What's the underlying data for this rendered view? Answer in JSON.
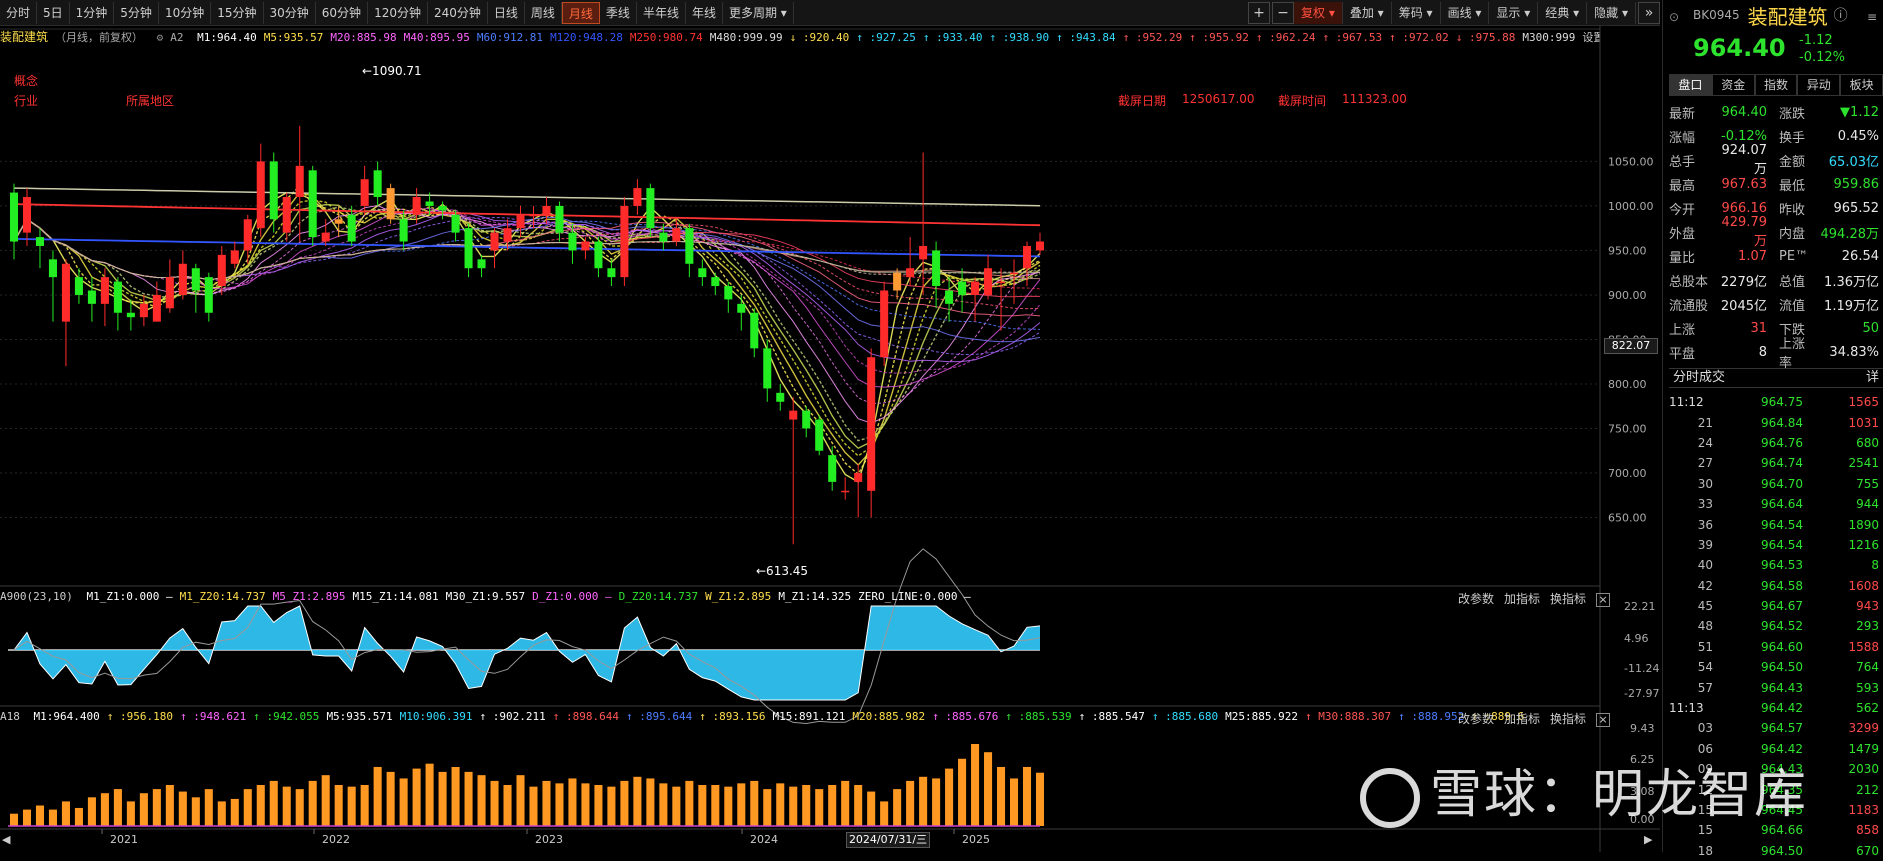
{
  "toolbar": {
    "periods": [
      "分时",
      "5日",
      "1分钟",
      "5分钟",
      "10分钟",
      "15分钟",
      "30分钟",
      "60分钟",
      "120分钟",
      "240分钟",
      "日线",
      "周线",
      "月线",
      "季线",
      "半年线",
      "年线",
      "更多周期"
    ],
    "active_period": "月线",
    "right": [
      "复权",
      "叠加",
      "筹码",
      "画线",
      "显示",
      "经典",
      "隐藏"
    ],
    "zoom_in": "+",
    "zoom_out": "−"
  },
  "chart": {
    "title": "装配建筑",
    "subtitle": "（月线，前复权）",
    "tag": "A2",
    "ma_items": [
      {
        "t": "M1:964.40",
        "c": "#ffffff"
      },
      {
        "t": "M5:935.57",
        "c": "#ffdf4c"
      },
      {
        "t": "M20:885.98",
        "c": "#ff66ff"
      },
      {
        "t": "M40:895.95",
        "c": "#ff66ff"
      },
      {
        "t": "M60:912.81",
        "c": "#4d7dff"
      },
      {
        "t": "M120:948.28",
        "c": "#3355ff"
      },
      {
        "t": "M250:980.74",
        "c": "#ff3333"
      },
      {
        "t": "M480:999.99",
        "c": "#dddddd"
      },
      {
        "t": "↓ :920.40",
        "c": "#ffdf4c"
      },
      {
        "t": "↑ :927.25",
        "c": "#33ddff"
      },
      {
        "t": "↑ :933.40",
        "c": "#33ddff"
      },
      {
        "t": "↑ :938.90",
        "c": "#33ddff"
      },
      {
        "t": "↑ :943.84",
        "c": "#33ddff"
      },
      {
        "t": "↑ :952.29",
        "c": "#ff5555"
      },
      {
        "t": "↑ :955.92",
        "c": "#ff5555"
      },
      {
        "t": "↑ :962.24",
        "c": "#ff5555"
      },
      {
        "t": "↑ :967.53",
        "c": "#ff5555"
      },
      {
        "t": "↑ :972.02",
        "c": "#ff5555"
      },
      {
        "t": "↓ :975.88",
        "c": "#ff5555"
      },
      {
        "t": "M300:999",
        "c": "#dddddd"
      }
    ],
    "settings": "设置均线",
    "concept_label": "概念",
    "industry_label": "行业",
    "region_label": "所属地区",
    "screen_date_label": "截屏日期",
    "screen_date": "1250617.00",
    "screen_time_label": "截屏时间",
    "screen_time": "111323.00",
    "high_marker": "←1090.71",
    "low_marker": "←613.45",
    "y_ticks": [
      "1050.00",
      "1000.00",
      "950.00",
      "900.00",
      "850.00",
      "800.00",
      "750.00",
      "700.00",
      "650.00"
    ],
    "cursor_value": "822.07",
    "x_labels": [
      "2021",
      "2022",
      "2023",
      "2024",
      "2025"
    ],
    "cursor_date": "2024/07/31/三"
  },
  "chart_data": [
    {
      "type": "candlestick",
      "title": "装配建筑",
      "ylim": [
        600,
        1110
      ],
      "open": [
        1015,
        970,
        965,
        940,
        870,
        920,
        905,
        890,
        915,
        880,
        875,
        870,
        885,
        900,
        930,
        920,
        910,
        935,
        950,
        975,
        1050,
        970,
        1010,
        1040,
        960,
        985,
        990,
        1000,
        1040,
        1020,
        985,
        990,
        1005,
        1000,
        990,
        975,
        940,
        950,
        960,
        975,
        990,
        990,
        1000,
        970,
        950,
        960,
        930,
        920,
        1000,
        1020,
        970,
        960,
        975,
        930,
        920,
        910,
        890,
        880,
        840,
        790,
        760,
        770,
        760,
        720,
        680,
        690,
        680,
        830,
        905,
        920,
        940,
        950,
        905,
        915,
        900,
        900,
        915,
        925,
        930,
        950
      ],
      "close": [
        960,
        1010,
        955,
        920,
        935,
        900,
        890,
        920,
        880,
        875,
        890,
        900,
        920,
        935,
        905,
        880,
        945,
        950,
        985,
        1050,
        985,
        1010,
        1045,
        965,
        970,
        980,
        960,
        1030,
        1010,
        985,
        960,
        1010,
        1000,
        995,
        970,
        930,
        930,
        970,
        975,
        990,
        990,
        1000,
        970,
        950,
        960,
        930,
        920,
        1000,
        1020,
        975,
        960,
        975,
        935,
        920,
        910,
        895,
        880,
        840,
        795,
        780,
        770,
        750,
        725,
        690,
        680,
        700,
        830,
        905,
        925,
        930,
        955,
        910,
        890,
        900,
        915,
        930,
        915,
        925,
        955,
        960
      ],
      "high": [
        1025,
        1020,
        975,
        950,
        940,
        930,
        920,
        930,
        920,
        895,
        900,
        915,
        940,
        950,
        935,
        925,
        955,
        960,
        990,
        1070,
        1060,
        1015,
        1090,
        1045,
        985,
        1000,
        1000,
        1045,
        1050,
        1025,
        995,
        1020,
        1015,
        1005,
        995,
        980,
        945,
        975,
        985,
        1000,
        1000,
        1010,
        1005,
        980,
        965,
        965,
        940,
        1010,
        1030,
        1025,
        980,
        985,
        980,
        940,
        925,
        915,
        900,
        885,
        850,
        800,
        785,
        775,
        765,
        730,
        695,
        710,
        840,
        915,
        930,
        965,
        1060,
        960,
        920,
        930,
        920,
        945,
        930,
        940,
        960,
        970
      ],
      "low": [
        940,
        955,
        930,
        870,
        820,
        890,
        870,
        865,
        860,
        860,
        865,
        870,
        880,
        895,
        880,
        870,
        900,
        930,
        935,
        965,
        970,
        960,
        960,
        955,
        955,
        965,
        955,
        990,
        1000,
        980,
        950,
        980,
        990,
        985,
        960,
        920,
        920,
        930,
        950,
        965,
        975,
        980,
        960,
        935,
        940,
        920,
        910,
        910,
        990,
        965,
        950,
        955,
        920,
        910,
        900,
        880,
        860,
        830,
        780,
        770,
        620,
        740,
        720,
        680,
        670,
        650,
        650,
        820,
        895,
        910,
        900,
        885,
        870,
        880,
        870,
        895,
        860,
        890,
        910,
        945
      ],
      "volume_levels": [
        0.15,
        0.2,
        0.25,
        0.2,
        0.3,
        0.22,
        0.35,
        0.4,
        0.45,
        0.3,
        0.4,
        0.45,
        0.5,
        0.42,
        0.35,
        0.45,
        0.3,
        0.33,
        0.45,
        0.5,
        0.55,
        0.48,
        0.45,
        0.55,
        0.62,
        0.5,
        0.48,
        0.5,
        0.72,
        0.66,
        0.58,
        0.7,
        0.76,
        0.66,
        0.72,
        0.66,
        0.62,
        0.55,
        0.5,
        0.62,
        0.48,
        0.55,
        0.52,
        0.58,
        0.52,
        0.5,
        0.48,
        0.55,
        0.6,
        0.58,
        0.52,
        0.48,
        0.55,
        0.5,
        0.5,
        0.48,
        0.52,
        0.55,
        0.45,
        0.52,
        0.48,
        0.5,
        0.45,
        0.5,
        0.55,
        0.5,
        0.42,
        0.3,
        0.45,
        0.55,
        0.6,
        0.58,
        0.7,
        0.82,
        1.0,
        0.9,
        0.72,
        0.58,
        0.72,
        0.65
      ]
    }
  ],
  "sub1": {
    "title": "A900(23,10)",
    "items": [
      {
        "t": "M1_Z1:0.000 —",
        "c": "#ffffff"
      },
      {
        "t": "M1_Z20:14.737",
        "c": "#ffdf4c"
      },
      {
        "t": "M5_Z1:2.895",
        "c": "#ff66ff"
      },
      {
        "t": "M15_Z1:14.081",
        "c": "#ffffff"
      },
      {
        "t": "M30_Z1:9.557",
        "c": "#ffffff"
      },
      {
        "t": "D_Z1:0.000 —",
        "c": "#ff66ff"
      },
      {
        "t": "D_Z20:14.737",
        "c": "#2ee32e"
      },
      {
        "t": "W_Z1:2.895",
        "c": "#ffdf4c"
      },
      {
        "t": "M_Z1:14.325",
        "c": "#ffffff"
      },
      {
        "t": "ZERO_LINE:0.000 —",
        "c": "#ffffff"
      }
    ],
    "y_ticks": [
      "22.21",
      "4.96",
      "-11.24",
      "-27.97"
    ],
    "controls": [
      "改参数",
      "加指标",
      "换指标"
    ]
  },
  "sub2": {
    "title": "A18",
    "items": [
      {
        "t": "M1:964.400",
        "c": "#ffffff"
      },
      {
        "t": "↑ :956.180",
        "c": "#ffdf4c"
      },
      {
        "t": "↑ :948.621",
        "c": "#ff66ff"
      },
      {
        "t": "↑ :942.055",
        "c": "#2ee32e"
      },
      {
        "t": "M5:935.571",
        "c": "#ffffff"
      },
      {
        "t": "M10:906.391",
        "c": "#33ddff"
      },
      {
        "t": "↑ :902.211",
        "c": "#ffffff"
      },
      {
        "t": "↑ :898.644",
        "c": "#ff5555"
      },
      {
        "t": "↑ :895.644",
        "c": "#4d7dff"
      },
      {
        "t": "↑ :893.156",
        "c": "#ffdf4c"
      },
      {
        "t": "M15:891.121",
        "c": "#ffffff"
      },
      {
        "t": "M20:885.982",
        "c": "#ffdf4c"
      },
      {
        "t": "↑ :885.676",
        "c": "#ff66ff"
      },
      {
        "t": "↑ :885.539",
        "c": "#2ee32e"
      },
      {
        "t": "↑ :885.547",
        "c": "#ffffff"
      },
      {
        "t": "↑ :885.680",
        "c": "#33ddff"
      },
      {
        "t": "M25:885.922",
        "c": "#ffffff"
      },
      {
        "t": "↑ M30:888.307",
        "c": "#ff5555"
      },
      {
        "t": "↑ :888.952",
        "c": "#4d7dff"
      },
      {
        "t": "↑ :889.6",
        "c": "#ffdf4c"
      }
    ],
    "y_ticks": [
      "9.43",
      "6.25",
      "3.08",
      "0.00"
    ],
    "controls": [
      "改参数",
      "加指标",
      "换指标"
    ]
  },
  "side": {
    "code": "BK0945",
    "name": "装配建筑",
    "price": "964.40",
    "change": "-1.12",
    "change_pct": "-0.12%",
    "tabs": [
      "盘口",
      "资金",
      "指数",
      "异动",
      "板块"
    ],
    "quote": [
      {
        "l1": "最新",
        "v1": "964.40",
        "c1": "g",
        "l2": "涨跌",
        "v2": "▼1.12",
        "c2": "g"
      },
      {
        "l1": "涨幅",
        "v1": "-0.12%",
        "c1": "g",
        "l2": "换手",
        "v2": "0.45%",
        "c2": "w"
      },
      {
        "l1": "总手",
        "v1": "924.07万",
        "c1": "w",
        "l2": "金额",
        "v2": "65.03亿",
        "c2": "c"
      },
      {
        "l1": "最高",
        "v1": "967.63",
        "c1": "r",
        "l2": "最低",
        "v2": "959.86",
        "c2": "g"
      },
      {
        "l1": "今开",
        "v1": "966.16",
        "c1": "r",
        "l2": "昨收",
        "v2": "965.52",
        "c2": "w"
      },
      {
        "l1": "外盘",
        "v1": "429.79万",
        "c1": "r",
        "l2": "内盘",
        "v2": "494.28万",
        "c2": "g"
      },
      {
        "l1": "量比",
        "v1": "1.07",
        "c1": "r",
        "l2": "PE™",
        "v2": "26.54",
        "c2": "w"
      },
      {
        "l1": "总股本",
        "v1": "2279亿",
        "c1": "w",
        "l2": "总值",
        "v2": "1.36万亿",
        "c2": "w"
      },
      {
        "l1": "流通股",
        "v1": "2045亿",
        "c1": "w",
        "l2": "流值",
        "v2": "1.19万亿",
        "c2": "w"
      },
      {
        "l1": "上涨",
        "v1": "31",
        "c1": "r",
        "l2": "下跌",
        "v2": "50",
        "c2": "g"
      },
      {
        "l1": "平盘",
        "v1": "8",
        "c1": "w",
        "l2": "上涨率",
        "v2": "34.83%",
        "c2": "w"
      }
    ],
    "ticks_title": "分时成交",
    "ticks_detail": "详",
    "ticks": [
      {
        "t": "11:12",
        "p": "964.75",
        "v": "1565",
        "vc": "r",
        "full": true
      },
      {
        "t": "21",
        "p": "964.84",
        "v": "1031",
        "vc": "r"
      },
      {
        "t": "24",
        "p": "964.76",
        "v": "680",
        "vc": "g"
      },
      {
        "t": "27",
        "p": "964.74",
        "v": "2541",
        "vc": "g"
      },
      {
        "t": "30",
        "p": "964.70",
        "v": "755",
        "vc": "g"
      },
      {
        "t": "33",
        "p": "964.64",
        "v": "944",
        "vc": "g"
      },
      {
        "t": "36",
        "p": "964.54",
        "v": "1890",
        "vc": "g"
      },
      {
        "t": "39",
        "p": "964.54",
        "v": "1216",
        "vc": "g"
      },
      {
        "t": "40",
        "p": "964.53",
        "v": "8",
        "vc": "g"
      },
      {
        "t": "42",
        "p": "964.58",
        "v": "1608",
        "vc": "r"
      },
      {
        "t": "45",
        "p": "964.67",
        "v": "943",
        "vc": "r"
      },
      {
        "t": "48",
        "p": "964.52",
        "v": "293",
        "vc": "g"
      },
      {
        "t": "51",
        "p": "964.60",
        "v": "1588",
        "vc": "r"
      },
      {
        "t": "54",
        "p": "964.50",
        "v": "764",
        "vc": "g"
      },
      {
        "t": "57",
        "p": "964.43",
        "v": "593",
        "vc": "g"
      },
      {
        "t": "11:13",
        "p": "964.42",
        "v": "562",
        "vc": "g",
        "full": true
      },
      {
        "t": "03",
        "p": "964.57",
        "v": "3299",
        "vc": "r"
      },
      {
        "t": "06",
        "p": "964.42",
        "v": "1479",
        "vc": "g"
      },
      {
        "t": "09",
        "p": "964.43",
        "v": "2030",
        "vc": "g"
      },
      {
        "t": "12",
        "p": "964.35",
        "v": "212",
        "vc": "g"
      },
      {
        "t": "15",
        "p": "964.45",
        "v": "1183",
        "vc": "r"
      },
      {
        "t": "15",
        "p": "964.66",
        "v": "858",
        "vc": "r"
      },
      {
        "t": "18",
        "p": "964.50",
        "v": "670",
        "vc": "g"
      }
    ]
  },
  "watermark": "雪球：明龙智库"
}
